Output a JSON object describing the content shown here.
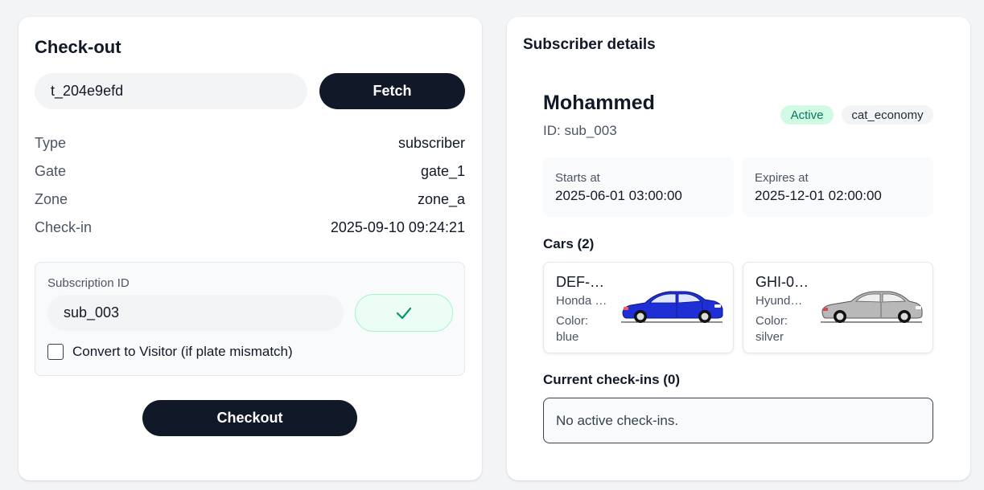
{
  "checkout": {
    "title": "Check-out",
    "ticket_value": "t_204e9efd",
    "fetch_label": "Fetch",
    "rows": [
      {
        "label": "Type",
        "value": "subscriber"
      },
      {
        "label": "Gate",
        "value": "gate_1"
      },
      {
        "label": "Zone",
        "value": "zone_a"
      },
      {
        "label": "Check-in",
        "value": "2025-09-10 09:24:21"
      }
    ],
    "subscription": {
      "label": "Subscription ID",
      "value": "sub_003",
      "verify_icon": "check-icon",
      "convert_label": "Convert to Visitor (if plate mismatch)",
      "convert_checked": false
    },
    "checkout_label": "Checkout"
  },
  "subscriber": {
    "title": "Subscriber details",
    "name": "Mohammed",
    "id_line": "ID: sub_003",
    "status_badge": "Active",
    "category_badge": "cat_economy",
    "starts_label": "Starts at",
    "starts_value": "2025-06-01 03:00:00",
    "expires_label": "Expires at",
    "expires_value": "2025-12-01 02:00:00",
    "cars_heading": "Cars (2)",
    "cars": [
      {
        "plate": "DEF-…",
        "model": "Honda …",
        "color_label": "Color:",
        "color_value": "blue",
        "image": "blue-sedan-image"
      },
      {
        "plate": "GHI-0…",
        "model": "Hyund…",
        "color_label": "Color:",
        "color_value": "silver",
        "image": "silver-sedan-image"
      }
    ],
    "checkins_heading": "Current check-ins (0)",
    "no_checkins_text": "No active check-ins."
  },
  "colors": {
    "primary_dark": "#111827",
    "active_badge_bg": "#d1fae5",
    "active_badge_text": "#047857",
    "check_green": "#059669",
    "car_1": "#1f2fd6",
    "car_2": "#b8b8b8"
  }
}
